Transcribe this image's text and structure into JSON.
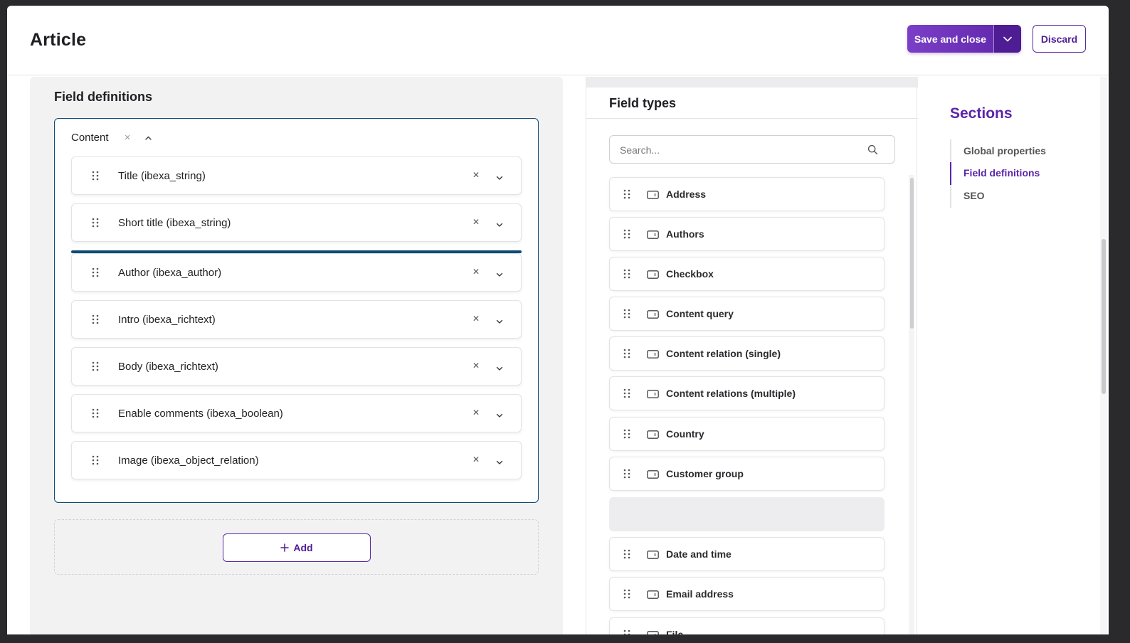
{
  "header": {
    "title": "Article",
    "save_label": "Save and close",
    "discard_label": "Discard"
  },
  "field_definitions": {
    "title": "Field definitions",
    "group": {
      "label": "Content",
      "fields": [
        {
          "name": "Title (ibexa_string)"
        },
        {
          "name": "Short title (ibexa_string)"
        },
        {
          "name": "Author (ibexa_author)"
        },
        {
          "name": "Intro (ibexa_richtext)"
        },
        {
          "name": "Body (ibexa_richtext)"
        },
        {
          "name": "Enable comments (ibexa_boolean)"
        },
        {
          "name": "Image (ibexa_object_relation)"
        }
      ]
    },
    "add_label": "Add"
  },
  "field_types": {
    "title": "Field types",
    "search_placeholder": "Search...",
    "items": [
      {
        "label": "Address"
      },
      {
        "label": "Authors"
      },
      {
        "label": "Checkbox"
      },
      {
        "label": "Content query"
      },
      {
        "label": "Content relation (single)"
      },
      {
        "label": "Content relations (multiple)"
      },
      {
        "label": "Country"
      },
      {
        "label": "Customer group"
      },
      {
        "label": "Date and time"
      },
      {
        "label": "Email address"
      },
      {
        "label": "File"
      }
    ]
  },
  "sections": {
    "title": "Sections",
    "items": [
      {
        "label": "Global properties",
        "active": false
      },
      {
        "label": "Field definitions",
        "active": true
      },
      {
        "label": "SEO",
        "active": false
      }
    ]
  },
  "colors": {
    "accent": "#5a25a8",
    "drop_indicator": "#0f4c75"
  }
}
